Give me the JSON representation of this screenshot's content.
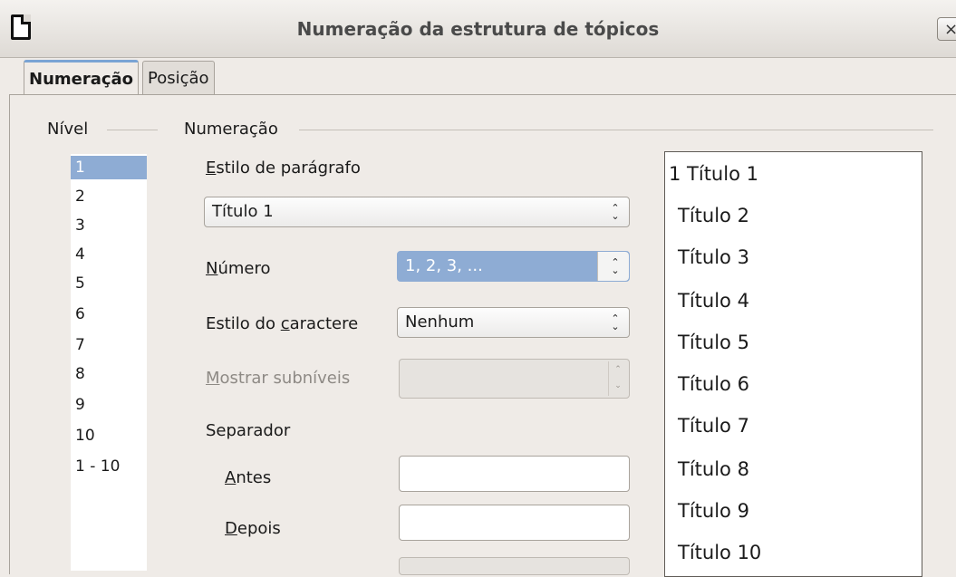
{
  "window": {
    "title": "Numeração da estrutura de tópicos",
    "close_glyph": "×"
  },
  "tabs": [
    {
      "label": "Numeração",
      "active": true
    },
    {
      "label": "Posição",
      "active": false
    }
  ],
  "level": {
    "heading": "Nível",
    "items": [
      "1",
      "2",
      "3",
      "4",
      "5",
      "6",
      "7",
      "8",
      "9",
      "10",
      "1 - 10"
    ],
    "selected_index": 0
  },
  "numbering": {
    "heading": "Numeração",
    "paragraph_style": {
      "label_pre": "",
      "label_u": "E",
      "label_post": "stilo de parágrafo",
      "value": "Título 1"
    },
    "number": {
      "label_pre": "",
      "label_u": "N",
      "label_post": "úmero",
      "value": "1, 2, 3, ..."
    },
    "char_style": {
      "label_pre": "Estilo do ",
      "label_u": "c",
      "label_post": "aractere",
      "value": "Nenhum"
    },
    "show_sublevels": {
      "label_pre": "",
      "label_u": "M",
      "label_post": "ostrar subníveis",
      "value": ""
    },
    "separator": {
      "heading": "Separador",
      "before": {
        "label_pre": "",
        "label_u": "A",
        "label_post": "ntes",
        "value": ""
      },
      "after": {
        "label_pre": "",
        "label_u": "D",
        "label_post": "epois",
        "value": ""
      }
    }
  },
  "preview": {
    "items": [
      "1 Título 1",
      "Título 2",
      "Título 3",
      "Título 4",
      "Título 5",
      "Título 6",
      "Título 7",
      "Título 8",
      "Título 9",
      "Título 10"
    ]
  },
  "colors": {
    "selection": "#8eacd4",
    "window_bg": "#efebe7",
    "active_tab_accent": "#7aa3d4"
  },
  "icons": {
    "app": "document-icon",
    "combo_arrows": "up-down-chevron-icon",
    "close": "close-icon"
  }
}
